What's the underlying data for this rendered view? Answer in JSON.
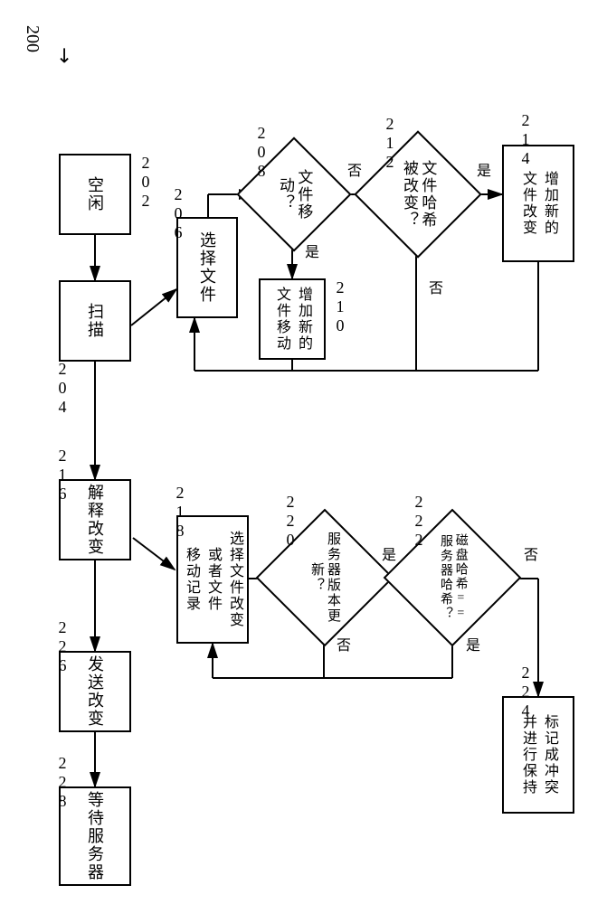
{
  "figure_ref": "200",
  "nodes": {
    "n202": {
      "label": "空闲",
      "ref": "202"
    },
    "n204": {
      "label": "扫描",
      "ref": "204"
    },
    "n206": {
      "label": "选择文件",
      "ref": "206"
    },
    "d208": {
      "label": "文件移动？",
      "ref": "208"
    },
    "n210": {
      "label": "增加新的\n文件移动",
      "ref": "210"
    },
    "d212": {
      "label": "文件哈希\n被改变？",
      "ref": "212"
    },
    "n214": {
      "label": "增加新的\n文件改变",
      "ref": "214"
    },
    "n216": {
      "label": "解释改变",
      "ref": "216"
    },
    "n218": {
      "label": "选择文件改变\n或者文件\n移动记录",
      "ref": "218"
    },
    "d220": {
      "label": "服务器版本更新？",
      "ref": "220"
    },
    "d222": {
      "label": "磁盘哈希==\n服务器哈希？",
      "ref": "222"
    },
    "n224": {
      "label": "标记成冲突\n并进行保持",
      "ref": "224"
    },
    "n226": {
      "label": "发送改变",
      "ref": "226"
    },
    "n228": {
      "label": "等待服务器",
      "ref": "228"
    }
  },
  "edges": {
    "yes1": "是",
    "no1": "否",
    "yes2": "是",
    "no2": "否",
    "yes3": "是",
    "no3": "否",
    "yes4": "是",
    "no4": "否"
  }
}
